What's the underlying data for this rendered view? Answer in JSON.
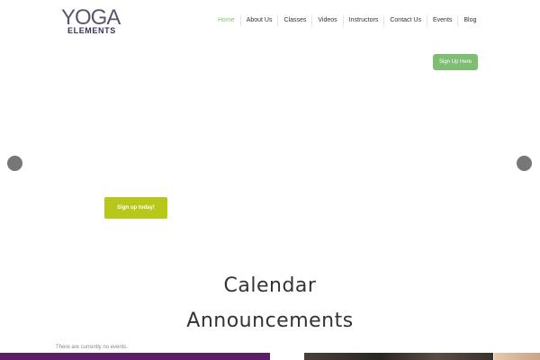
{
  "logo": {
    "top_text": "YOGA",
    "bottom_text": "ELEMENTS"
  },
  "nav": {
    "items": [
      {
        "label": "Home",
        "active": true
      },
      {
        "label": "About Us",
        "active": false
      },
      {
        "label": "Classes",
        "active": false
      },
      {
        "label": "Videos",
        "active": false
      },
      {
        "label": "Instructors",
        "active": false
      },
      {
        "label": "Contact Us",
        "active": false
      },
      {
        "label": "Events",
        "active": false
      },
      {
        "label": "Blog",
        "active": false
      }
    ]
  },
  "header_cta": {
    "label": "Sign Up Here",
    "color": "#7fbd74"
  },
  "slider": {
    "prev_icon": "circle-arrow-left-icon",
    "next_icon": "circle-arrow-right-icon",
    "cta_label": "Sign up today!",
    "cta_color": "#b8c81a"
  },
  "calendar": {
    "title": "Calendar"
  },
  "announcements": {
    "title": "Announcements",
    "empty_text": "There are currently no events."
  },
  "colors": {
    "accent_green": "#8dbf6f",
    "brand_purple": "#5a1f66"
  }
}
